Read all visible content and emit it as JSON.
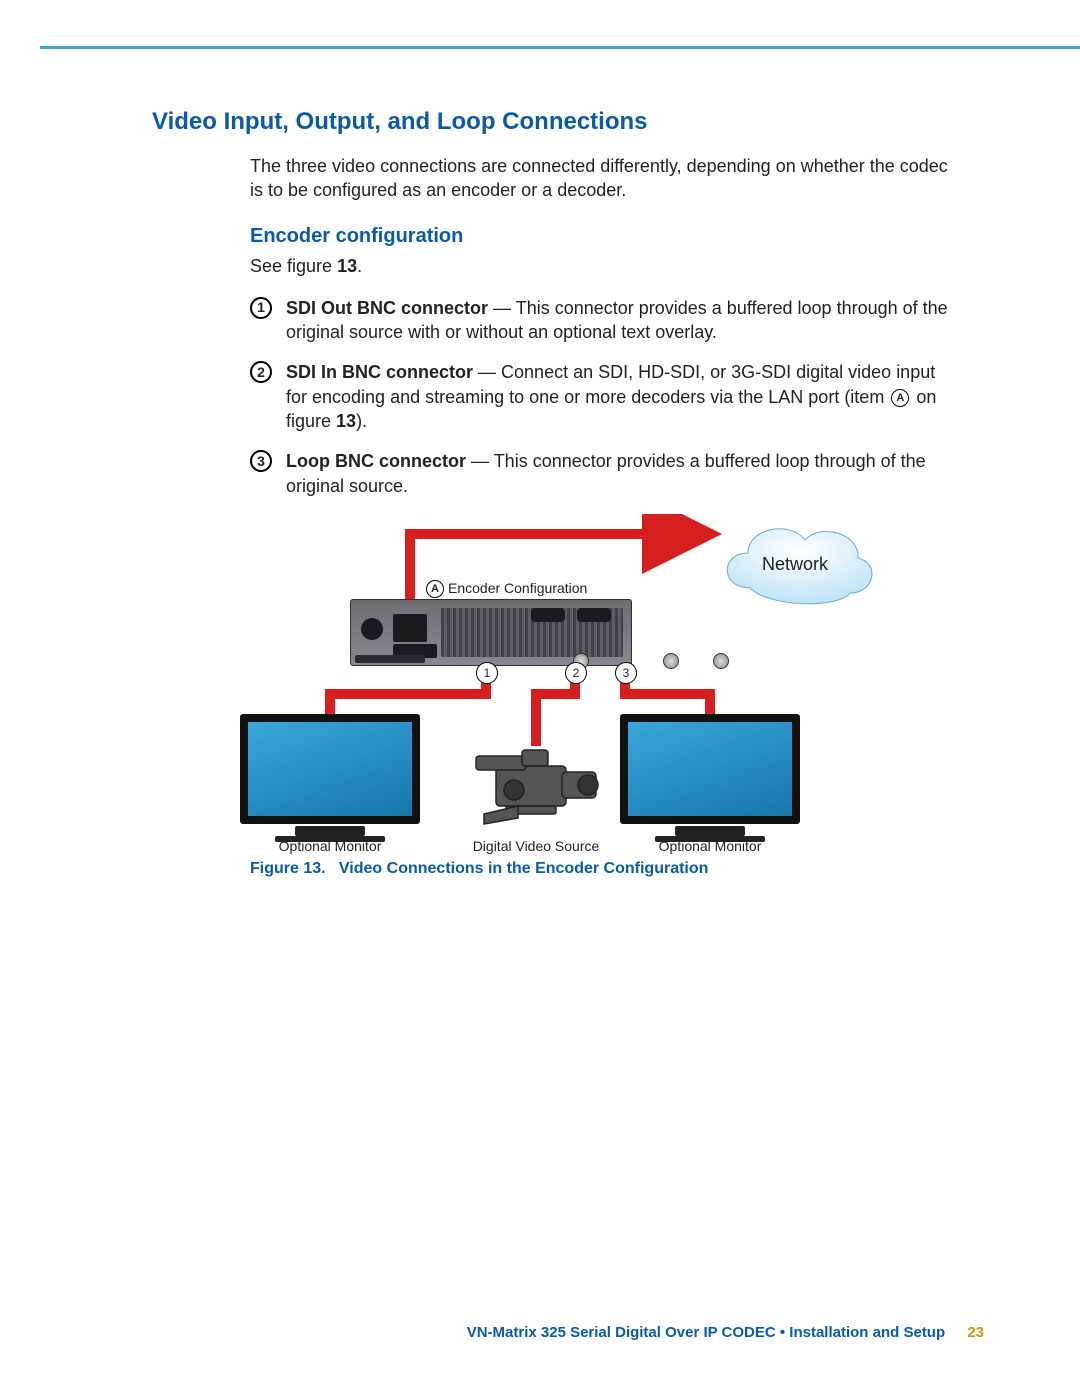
{
  "header": {
    "title": "Video Input, Output, and Loop Connections"
  },
  "intro": "The three video connections are connected differently, depending on whether the codec is to be configured as an encoder or a decoder.",
  "section": {
    "title": "Encoder configuration",
    "see_prefix": "See figure ",
    "see_ref": "13",
    "see_suffix": "."
  },
  "items": [
    {
      "num": "1",
      "bold": "SDI Out BNC connector",
      "dash": " — ",
      "text": "This connector provides a buffered loop through of the original source with or without an optional text overlay."
    },
    {
      "num": "2",
      "bold": "SDI In BNC connector",
      "dash": " — ",
      "text_a": "Connect an SDI, HD-SDI, or 3G-SDI digital video input for encoding and streaming to one or more decoders via the LAN port (item ",
      "ref_letter": "A",
      "text_b": " on figure ",
      "ref_fig": "13",
      "text_c": ")."
    },
    {
      "num": "3",
      "bold": "Loop BNC connector",
      "dash": " — ",
      "text": "This connector provides a buffered loop through of the original source."
    }
  ],
  "figure": {
    "enc_letter": "A",
    "enc_label": "Encoder Configuration",
    "cloud": "Network",
    "call1": "1",
    "call2": "2",
    "call3": "3",
    "label_left": "Optional Monitor",
    "label_mid": "Digital Video Source",
    "label_right": "Optional Monitor",
    "cap_no": "Figure 13.",
    "cap_title": "Video Connections in the Encoder Configuration"
  },
  "footer": {
    "text": "VN-Matrix 325 Serial Digital Over IP CODEC • Installation and Setup",
    "page": "23"
  }
}
